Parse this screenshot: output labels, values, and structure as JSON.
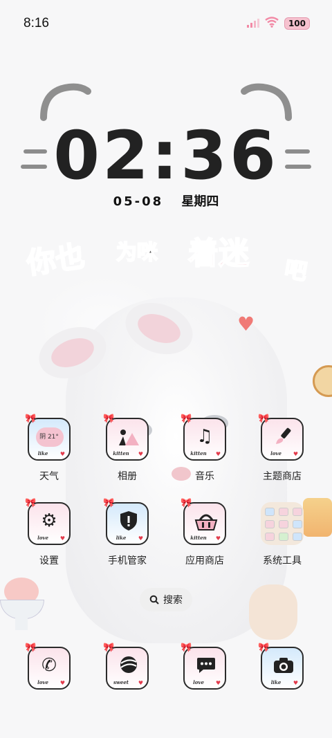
{
  "status_bar": {
    "time": "8:16",
    "battery": "100"
  },
  "clock": {
    "time": "02:36",
    "date": "05-08",
    "weekday": "星期四"
  },
  "slogan": {
    "part1": "你也",
    "part2": "为咪",
    "part3": "着迷",
    "part4": "吧"
  },
  "apps": [
    {
      "label": "天气",
      "brand": "like",
      "icon": "weather-icon",
      "tile_text": "阴 21°"
    },
    {
      "label": "相册",
      "brand": "kitten",
      "icon": "gallery-icon"
    },
    {
      "label": "音乐",
      "brand": "kitten",
      "icon": "music-icon"
    },
    {
      "label": "主题商店",
      "brand": "love",
      "icon": "theme-store-icon"
    },
    {
      "label": "设置",
      "brand": "love",
      "icon": "settings-icon"
    },
    {
      "label": "手机管家",
      "brand": "like",
      "icon": "phone-manager-icon"
    },
    {
      "label": "应用商店",
      "brand": "kitten",
      "icon": "app-store-icon"
    },
    {
      "label": "系统工具",
      "icon": "folder-icon"
    }
  ],
  "search": {
    "label": "搜索"
  },
  "dock": [
    {
      "brand": "love",
      "icon": "phone-icon"
    },
    {
      "brand": "sweet",
      "icon": "browser-icon"
    },
    {
      "brand": "love",
      "icon": "messages-icon"
    },
    {
      "brand": "like",
      "icon": "camera-icon"
    }
  ],
  "colors": {
    "pink_tile": "#fbe3eb",
    "blue_tile": "#d4e9fb",
    "heart": "#e23a4b",
    "slogan_blue": "#a9d6f2",
    "slogan_pink": "#f3a0b0",
    "slogan_gray": "#555555"
  }
}
